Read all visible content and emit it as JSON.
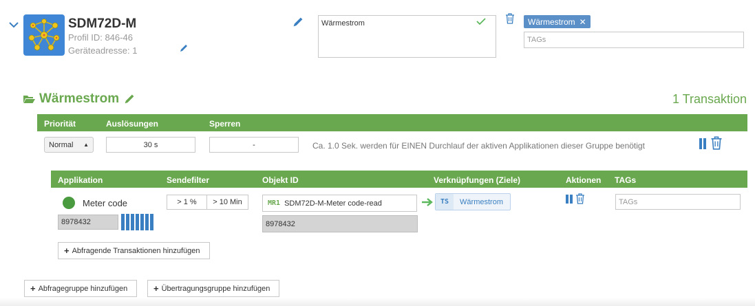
{
  "device": {
    "name": "SDM72D-M",
    "profile_id": "Profil ID: 846-46",
    "address": "Geräteadresse: 1",
    "icon": "device-network-icon",
    "note_text": "Wärmestrom",
    "tag_chip": "Wärmestrom",
    "tag_placeholder": "TAGs"
  },
  "group": {
    "title": "Wärmestrom",
    "transactions_count": "1 Transaktion",
    "headers": {
      "priority": "Priorität",
      "triggers": "Auslösungen",
      "locks": "Sperren"
    },
    "priority_value": "Normal",
    "triggers_value": "30 s",
    "locks_value": "-",
    "hint": "Ca. 1.0 Sek. werden für EINEN Durchlauf der aktiven Applikationen dieser Gruppe benötigt"
  },
  "app_table": {
    "headers": {
      "application": "Applikation",
      "send_filter": "Sendefilter",
      "object_id": "Objekt ID",
      "links": "Verknüpfungen (Ziele)",
      "actions": "Aktionen",
      "tags": "TAGs"
    },
    "row": {
      "status_color": "#4a9a3f",
      "name": "Meter code",
      "value": "8978432",
      "filter_pct": "> 1 %",
      "filter_time": "> 10 Min",
      "object_prefix": "MR1",
      "object_name": "SDM72D-M-Meter code-read",
      "object_value": "8978432",
      "link_prefix": "TS",
      "link_name": "Wärmestrom",
      "tag_placeholder": "TAGs"
    },
    "add_query_button": "Abfragende Transaktionen hinzufügen"
  },
  "footer": {
    "add_query_group": "Abfragegruppe hinzufügen",
    "add_transfer_group": "Übertragungsgruppe hinzufügen"
  },
  "colors": {
    "accent_green": "#6aa84f",
    "accent_blue": "#3a7fc1",
    "tag_chip": "#5b8fc7"
  }
}
